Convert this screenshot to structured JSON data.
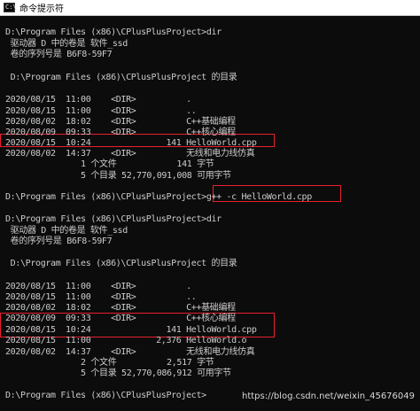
{
  "window": {
    "title": "命令提示符",
    "icon": "console-icon"
  },
  "colors": {
    "background": "#0c0c0c",
    "text": "#cccccc",
    "highlight_box": "#e8212e"
  },
  "console": {
    "lines": [
      "D:\\Program Files (x86)\\CPlusPlusProject>dir",
      " 驱动器 D 中的卷是 软件_ssd",
      " 卷的序列号是 B6F8-59F7",
      "",
      " D:\\Program Files (x86)\\CPlusPlusProject 的目录",
      "",
      "2020/08/15  11:00    <DIR>          .",
      "2020/08/15  11:00    <DIR>          ..",
      "2020/08/02  18:02    <DIR>          C++基础编程",
      "2020/08/09  09:33    <DIR>          C++核心编程",
      "2020/08/15  10:24               141 HelloWorld.cpp",
      "2020/08/02  14:37    <DIR>          无线和电力线仿真",
      "               1 个文件            141 字节",
      "               5 个目录 52,770,091,008 可用字节",
      "",
      "D:\\Program Files (x86)\\CPlusPlusProject>g++ -c HelloWorld.cpp",
      "",
      "D:\\Program Files (x86)\\CPlusPlusProject>dir",
      " 驱动器 D 中的卷是 软件_ssd",
      " 卷的序列号是 B6F8-59F7",
      "",
      " D:\\Program Files (x86)\\CPlusPlusProject 的目录",
      "",
      "2020/08/15  11:00    <DIR>          .",
      "2020/08/15  11:00    <DIR>          ..",
      "2020/08/02  18:02    <DIR>          C++基础编程",
      "2020/08/09  09:33    <DIR>          C++核心编程",
      "2020/08/15  10:24               141 HelloWorld.cpp",
      "2020/08/15  11:00             2,376 HelloWorld.o",
      "2020/08/02  14:37    <DIR>          无线和电力线仿真",
      "               2 个文件          2,517 字节",
      "               5 个目录 52,770,086,912 可用字节",
      "",
      "D:\\Program Files (x86)\\CPlusPlusProject>"
    ]
  },
  "watermark": "https://blog.csdn.net/weixin_45676049"
}
